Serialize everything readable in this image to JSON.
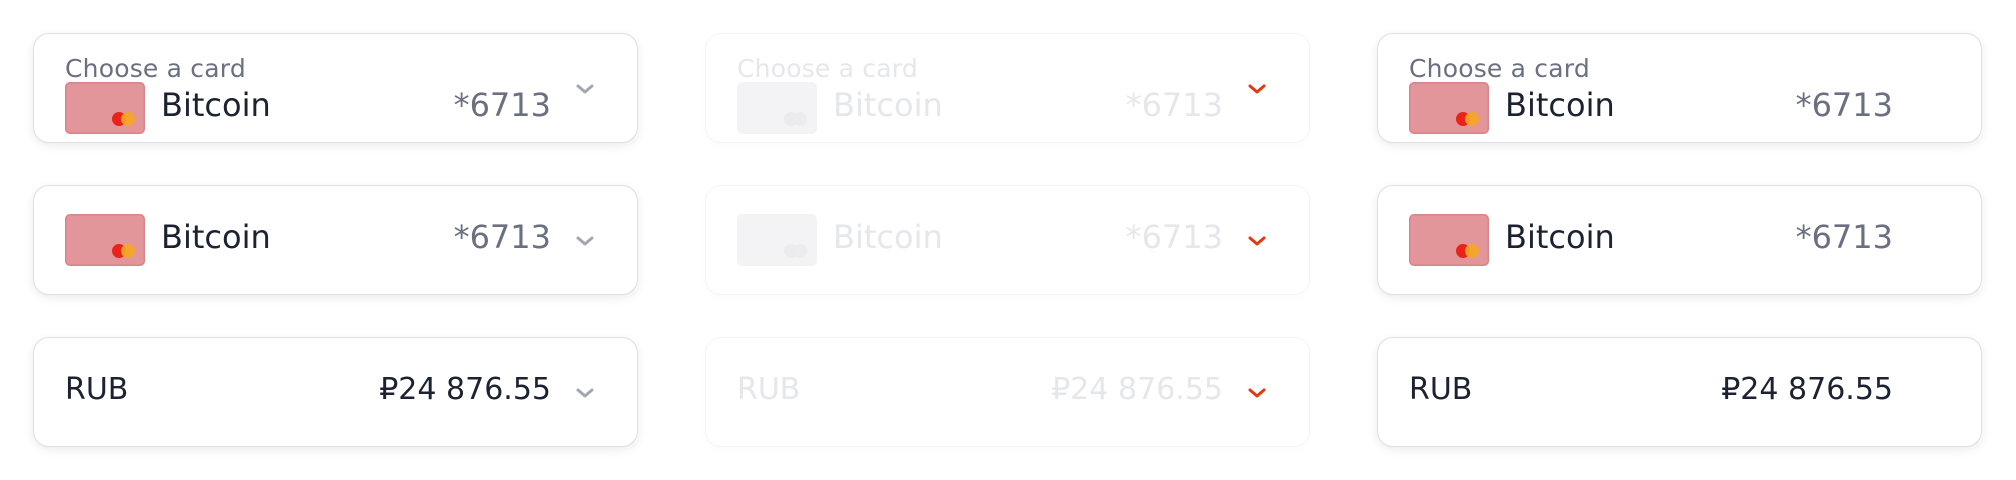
{
  "states": [
    {
      "card_with_label": {
        "label": "Choose a card",
        "name": "Bitcoin",
        "number": "*6713",
        "chevron_icon": "chevron-down-icon"
      },
      "card": {
        "name": "Bitcoin",
        "number": "*6713",
        "chevron_icon": "chevron-down-icon"
      },
      "account": {
        "currency": "RUB",
        "amount": "₽24 876.55",
        "chevron_icon": "chevron-down-icon"
      }
    },
    {
      "card_with_label": {
        "label": "Choose a card",
        "name": "Bitcoin",
        "number": "*6713",
        "chevron_icon": "chevron-down-icon"
      },
      "card": {
        "name": "Bitcoin",
        "number": "*6713",
        "chevron_icon": "chevron-down-icon"
      },
      "account": {
        "currency": "RUB",
        "amount": "₽24 876.55",
        "chevron_icon": "chevron-down-icon"
      }
    },
    {
      "card_with_label": {
        "label": "Choose a card",
        "name": "Bitcoin",
        "number": "*6713"
      },
      "card": {
        "name": "Bitcoin",
        "number": "*6713"
      },
      "account": {
        "currency": "RUB",
        "amount": "₽24 876.55"
      }
    }
  ],
  "colors": {
    "text_primary": "#1c2232",
    "text_secondary": "#6b6f80",
    "card_face": "#e3969a",
    "chevron_default": "#a3a6b3",
    "chevron_disabled_accent": "#e03a12",
    "border": "#dedfe5"
  }
}
